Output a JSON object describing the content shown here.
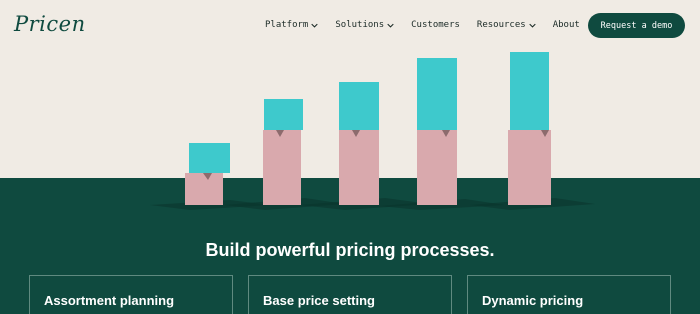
{
  "brand": {
    "logo_text": "Pricen"
  },
  "nav": {
    "items": [
      {
        "label": "Platform",
        "has_dropdown": true
      },
      {
        "label": "Solutions",
        "has_dropdown": true
      },
      {
        "label": "Customers",
        "has_dropdown": false
      },
      {
        "label": "Resources",
        "has_dropdown": true
      },
      {
        "label": "About",
        "has_dropdown": false
      }
    ],
    "cta_label": "Request a demo"
  },
  "hero": {
    "headline": "Build powerful pricing processes."
  },
  "cards": [
    {
      "title": "Assortment planning"
    },
    {
      "title": "Base price setting"
    },
    {
      "title": "Dynamic pricing"
    }
  ],
  "colors": {
    "brand_green": "#0f4a3f",
    "background": "#f0ebe4",
    "teal_block": "#3ec9cc",
    "pink_block": "#d9a9ad"
  }
}
